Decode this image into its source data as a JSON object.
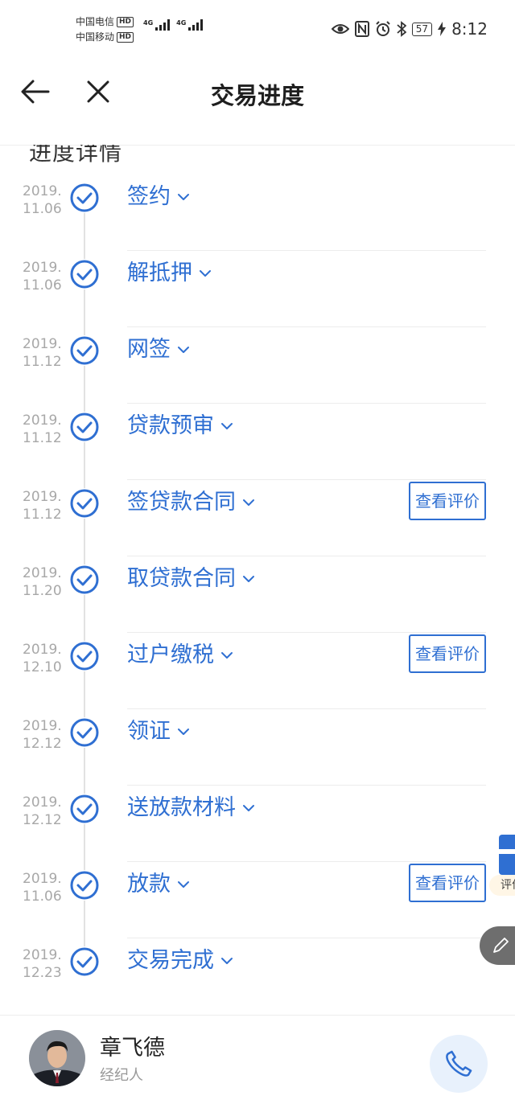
{
  "status_bar": {
    "carrier1": "中国电信",
    "carrier2": "中国移动",
    "hd": "HD",
    "network1": "4G",
    "network2": "4G",
    "battery": "57",
    "time": "8:12"
  },
  "nav": {
    "title": "交易进度",
    "back_icon": "arrow-left-icon",
    "close_icon": "close-icon"
  },
  "section_title": "进度详情",
  "steps": [
    {
      "date_year": "2019.",
      "date_day": "11.06",
      "label": "签约",
      "review": ""
    },
    {
      "date_year": "2019.",
      "date_day": "11.06",
      "label": "解抵押",
      "review": ""
    },
    {
      "date_year": "2019.",
      "date_day": "11.12",
      "label": "网签",
      "review": ""
    },
    {
      "date_year": "2019.",
      "date_day": "11.12",
      "label": "贷款预审",
      "review": ""
    },
    {
      "date_year": "2019.",
      "date_day": "11.12",
      "label": "签贷款合同",
      "review": "查看评价"
    },
    {
      "date_year": "2019.",
      "date_day": "11.20",
      "label": "取贷款合同",
      "review": ""
    },
    {
      "date_year": "2019.",
      "date_day": "12.10",
      "label": "过户缴税",
      "review": "查看评价"
    },
    {
      "date_year": "2019.",
      "date_day": "12.12",
      "label": "领证",
      "review": ""
    },
    {
      "date_year": "2019.",
      "date_day": "12.12",
      "label": "送放款材料",
      "review": ""
    },
    {
      "date_year": "2019.",
      "date_day": "11.06",
      "label": "放款",
      "review": "查看评价"
    },
    {
      "date_year": "2019.",
      "date_day": "12.23",
      "label": "交易完成",
      "review": ""
    }
  ],
  "float_gift": {
    "tag": "评价"
  },
  "agent": {
    "name": "章飞德",
    "role": "经纪人"
  },
  "colors": {
    "accent": "#2f6fd2",
    "date_gray": "#a8a8a8"
  }
}
